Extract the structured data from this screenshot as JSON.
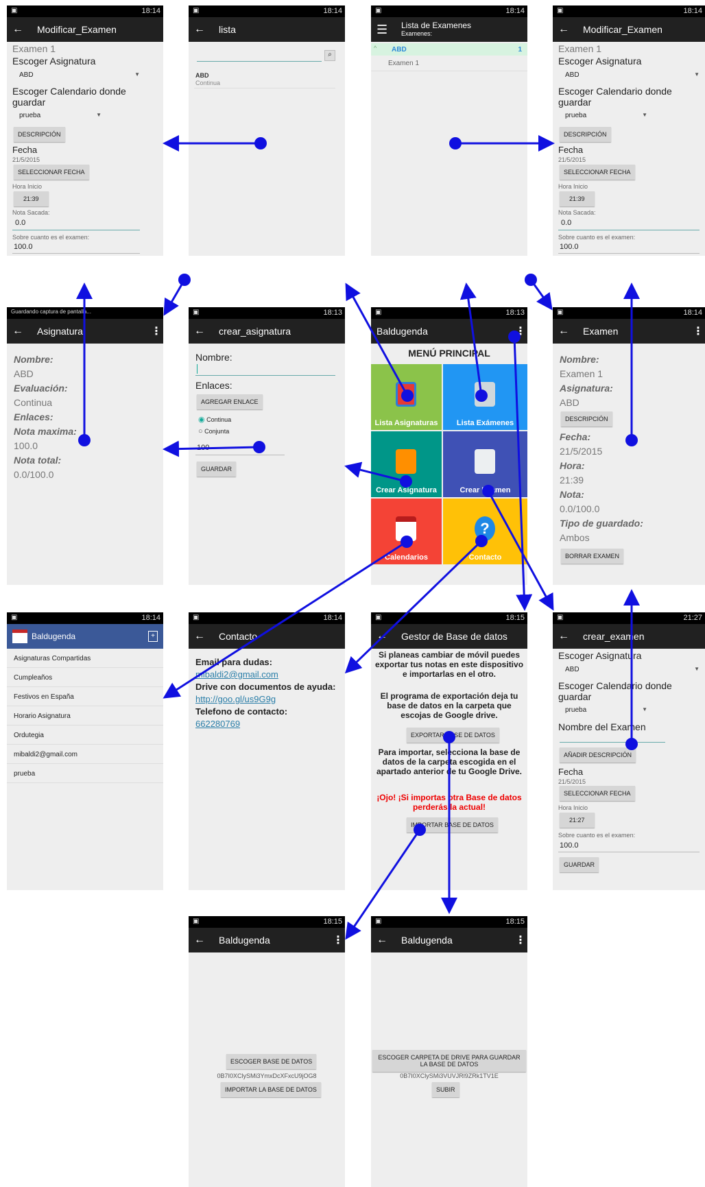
{
  "status": {
    "t1814": "18:14",
    "t1813": "18:13",
    "t1815": "18:15",
    "t2127": "21:27",
    "t1814b": "18:14",
    "saving": "Guardando captura de pantalla..."
  },
  "s1": {
    "title": "Modificar_Examen",
    "exam": "Examen 1",
    "pick_subject": "Escoger Asignatura",
    "subject": "ABD",
    "pick_cal": "Escoger Calendario donde guardar",
    "cal": "prueba",
    "desc_btn": "DESCRIPCIÓN",
    "fecha": "Fecha",
    "date": "21/5/2015",
    "pick_date": "SELECCIONAR FECHA",
    "hora_inicio": "Hora Inicio",
    "time": "21:39",
    "nota_sacada": "Nota Sacada:",
    "nota": "0.0",
    "sobre": "Sobre cuanto es el examen:",
    "max": "100.0"
  },
  "s2": {
    "title": "lista",
    "item_name": "ABD",
    "item_sub": "Continua"
  },
  "s3": {
    "title": "Lista de Examenes",
    "subtitle": "Examenes:",
    "group": "ABD",
    "count": "1",
    "child": "Examen 1"
  },
  "s5": {
    "title": "Asignatura",
    "nombre_l": "Nombre:",
    "nombre_v": "ABD",
    "eval_l": "Evaluación:",
    "eval_v": "Continua",
    "enl_l": "Enlaces:",
    "nmax_l": "Nota maxima:",
    "nmax_v": "100.0",
    "ntot_l": "Nota total:",
    "ntot_v": "0.0/100.0"
  },
  "s6": {
    "title": "crear_asignatura",
    "nombre": "Nombre:",
    "enlaces": "Enlaces:",
    "add_link": "AGREGAR ENLACE",
    "opt1": "Continua",
    "opt2": "Conjunta",
    "value": "100",
    "save": "GUARDAR"
  },
  "s7": {
    "title": "Baldugenda",
    "menu": "MENÚ PRINCIPAL",
    "t1": "Lista Asignaturas",
    "t2": "Lista Exámenes",
    "t3": "Crear Asignatura",
    "t4": "Crear Examen",
    "t5": "Calendarios",
    "t6": "Contacto"
  },
  "s8": {
    "title": "Examen",
    "nombre_l": "Nombre:",
    "nombre_v": "Examen 1",
    "asig_l": "Asignatura:",
    "asig_v": "ABD",
    "desc_btn": "DESCRIPCIÓN",
    "fecha_l": "Fecha:",
    "fecha_v": "21/5/2015",
    "hora_l": "Hora:",
    "hora_v": "21:39",
    "nota_l": "Nota:",
    "nota_v": "0.0/100.0",
    "tipo_l": "Tipo de guardado:",
    "tipo_v": "Ambos",
    "delete": "BORRAR EXAMEN"
  },
  "s9": {
    "title": "Baldugenda",
    "items": [
      "Asignaturas Compartidas",
      "Cumpleaños",
      "Festivos en España",
      "Horario Asignatura",
      "Ordutegia",
      "mibaldi2@gmail.com",
      "prueba"
    ]
  },
  "s10": {
    "title": "Contacto",
    "email_l": "Email para dudas:",
    "email": "mibaldi2@gmail.com",
    "drive_l": "Drive con documentos de ayuda:",
    "drive": "http://goo.gl/us9G9g",
    "tel_l": "Telefono de contacto:",
    "tel": "662280769"
  },
  "s11": {
    "title": "Gestor de Base de datos",
    "p1": "Si planeas cambiar de móvil puedes exportar tus notas en este dispositivo e importarlas en el otro.",
    "p2": "El programa de exportación deja tu base de datos en la carpeta que escojas de Google drive.",
    "export": "EXPORTAR BASE DE DATOS",
    "p3": "Para importar, selecciona la base de datos de la carpeta escogida en el apartado anterior de tu Google Drive.",
    "warn": "¡Ojo! ¡Si importas otra Base de datos perderás la actual!",
    "import": "IMPORTAR BASE DE DATOS"
  },
  "s12": {
    "title": "crear_examen",
    "pick_subject": "Escoger Asignatura",
    "subject": "ABD",
    "pick_cal": "Escoger Calendario donde guardar",
    "cal": "prueba",
    "exam_name": "Nombre del Examen",
    "add_desc": "AÑADIR DESCRIPCIÓN",
    "fecha": "Fecha",
    "date": "21/5/2015",
    "pick_date": "SELECCIONAR FECHA",
    "hora_inicio": "Hora Inicio",
    "time": "21:27",
    "sobre": "Sobre cuanto es el examen:",
    "max": "100.0",
    "save": "GUARDAR"
  },
  "s13": {
    "title": "Baldugenda",
    "choose": "ESCOGER BASE DE DATOS",
    "id": "0B7I0XClySMi3YmxDcXFxcU9jOG8",
    "import": "IMPORTAR LA BASE DE DATOS"
  },
  "s14": {
    "title": "Baldugenda",
    "choose": "ESCOGER CARPETA DE DRIVE PARA GUARDAR LA BASE DE DATOS",
    "id": "0B7I0XClySMi3VUVJRl9ZRk1TV1E",
    "upload": "SUBIR"
  },
  "colors": {
    "arrow": "#1010e0",
    "bar": "#212121",
    "green": "#8bc34a",
    "blue": "#2196f3",
    "teal": "#009688",
    "indigo": "#3f51b5",
    "red": "#f44336",
    "amber": "#ffc107"
  }
}
